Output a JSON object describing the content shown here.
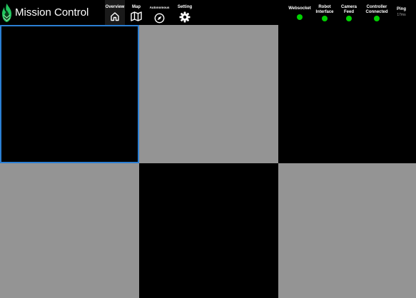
{
  "app": {
    "title": "Mission Control",
    "logo_icon": "flame-logo-icon",
    "accent_color": "#22c55e"
  },
  "nav": {
    "active": "Overview",
    "tabs": [
      {
        "label": "Overview",
        "icon": "home-icon"
      },
      {
        "label": "Map",
        "icon": "map-icon"
      },
      {
        "label": "Autonomous",
        "icon": "compass-icon"
      },
      {
        "label": "Setting",
        "icon": "gear-icon"
      }
    ]
  },
  "status": {
    "indicator_color": "#00d100",
    "items": [
      {
        "label_lines": [
          "Websocket"
        ]
      },
      {
        "label_lines": [
          "Robot",
          "Interface"
        ]
      },
      {
        "label_lines": [
          "Camera",
          "Feed"
        ]
      },
      {
        "label_lines": [
          "Controller",
          "Connected"
        ]
      }
    ],
    "ping": {
      "label": "Ping",
      "value": "17ms"
    }
  },
  "panels": {
    "selected_index": 0,
    "selected_border_color": "#2b7fd4",
    "colors": [
      "#000000",
      "#949494",
      "#000000",
      "#949494",
      "#000000",
      "#949494"
    ]
  }
}
